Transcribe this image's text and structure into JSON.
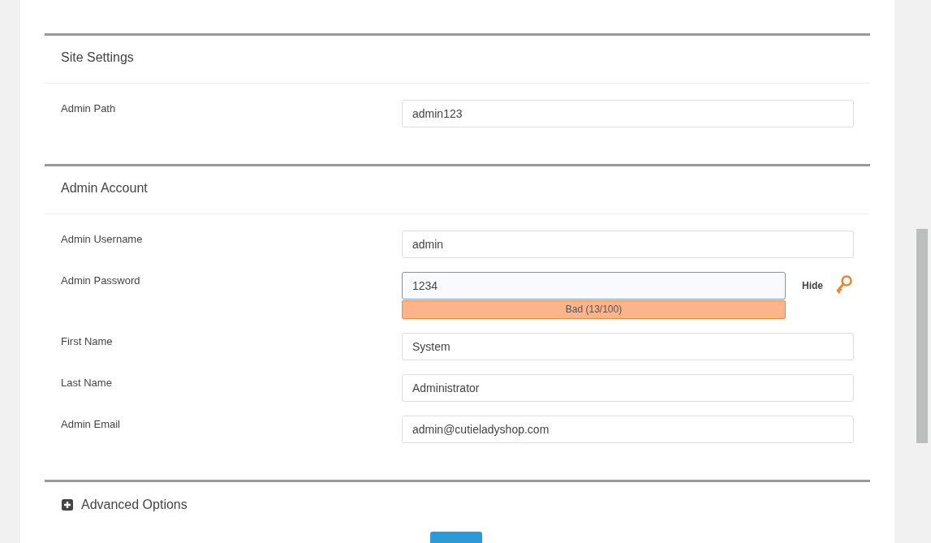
{
  "sections": [
    {
      "title": "Site Settings",
      "fields": [
        {
          "label": "Admin Path",
          "value": "admin123",
          "focused": false
        }
      ]
    },
    {
      "title": "Admin Account",
      "fields": [
        {
          "label": "Admin Username",
          "value": "admin",
          "focused": false
        },
        {
          "label": "Admin Password",
          "value": "1234",
          "focused": true,
          "toggle": "Hide",
          "strength": "Bad (13/100)"
        },
        {
          "label": "First Name",
          "value": "System",
          "focused": false
        },
        {
          "label": "Last Name",
          "value": "Administrator",
          "focused": false
        },
        {
          "label": "Admin Email",
          "value": "admin@cutieladyshop.com",
          "focused": false
        }
      ]
    }
  ],
  "advanced": {
    "label": "Advanced Options",
    "expanded": false
  }
}
